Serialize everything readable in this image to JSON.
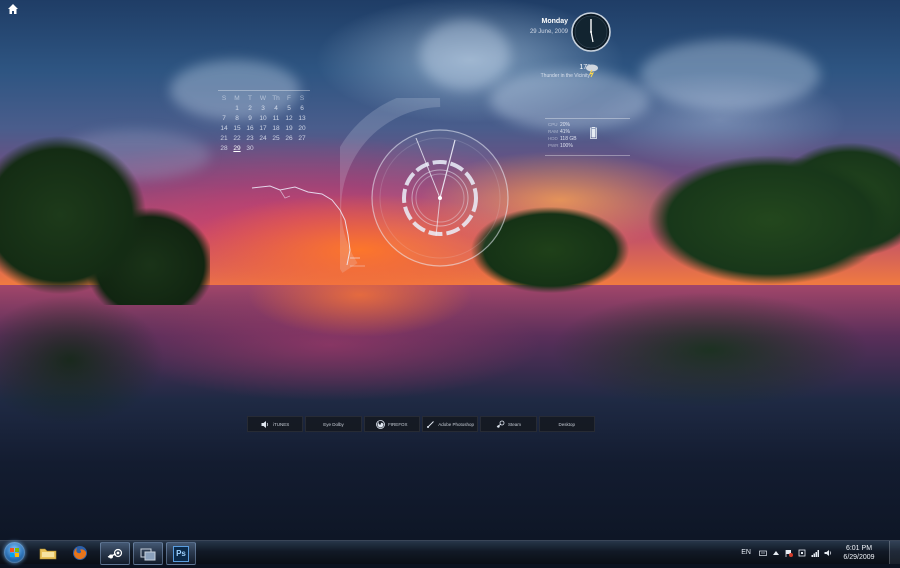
{
  "calendar": {
    "headers": [
      "S",
      "M",
      "T",
      "W",
      "Th",
      "F",
      "S"
    ],
    "weeks": [
      [
        "",
        "1",
        "2",
        "3",
        "4",
        "5",
        "6"
      ],
      [
        "7",
        "8",
        "9",
        "10",
        "11",
        "12",
        "13"
      ],
      [
        "14",
        "15",
        "16",
        "17",
        "18",
        "19",
        "20"
      ],
      [
        "21",
        "22",
        "23",
        "24",
        "25",
        "26",
        "27"
      ],
      [
        "28",
        "29",
        "30",
        "",
        "",
        "",
        ""
      ]
    ],
    "today": "29"
  },
  "clock": {
    "day": "Monday",
    "date": "29 June, 2009"
  },
  "weather": {
    "temp": "17°",
    "condition": "Thunder in the Vicinity"
  },
  "stats": [
    {
      "label": "CPU",
      "value": "20%"
    },
    {
      "label": "RAM",
      "value": "41%"
    },
    {
      "label": "HDD",
      "value": "118 GB"
    },
    {
      "label": "PWR",
      "value": "100%"
    }
  ],
  "dock": [
    {
      "label": "iTUNES",
      "icon": "speaker-icon"
    },
    {
      "label": "Eye Dolby",
      "icon": ""
    },
    {
      "label": "FIREFOX",
      "icon": "firefox-icon"
    },
    {
      "label": "Adobe Photoshop",
      "icon": "brush-icon"
    },
    {
      "label": "Steam",
      "icon": "steam-icon"
    },
    {
      "label": "Desktop",
      "icon": ""
    }
  ],
  "taskbar": {
    "items": [
      {
        "name": "explorer",
        "icon": "folder-icon"
      },
      {
        "name": "firefox",
        "icon": "firefox-icon"
      },
      {
        "name": "steam",
        "icon": "steam-icon"
      },
      {
        "name": "vmware",
        "icon": "vm-icon"
      },
      {
        "name": "photoshop",
        "icon": "photoshop-icon",
        "text": "Ps"
      }
    ],
    "language": "EN",
    "time": "6:01 PM",
    "date": "6/29/2009"
  }
}
